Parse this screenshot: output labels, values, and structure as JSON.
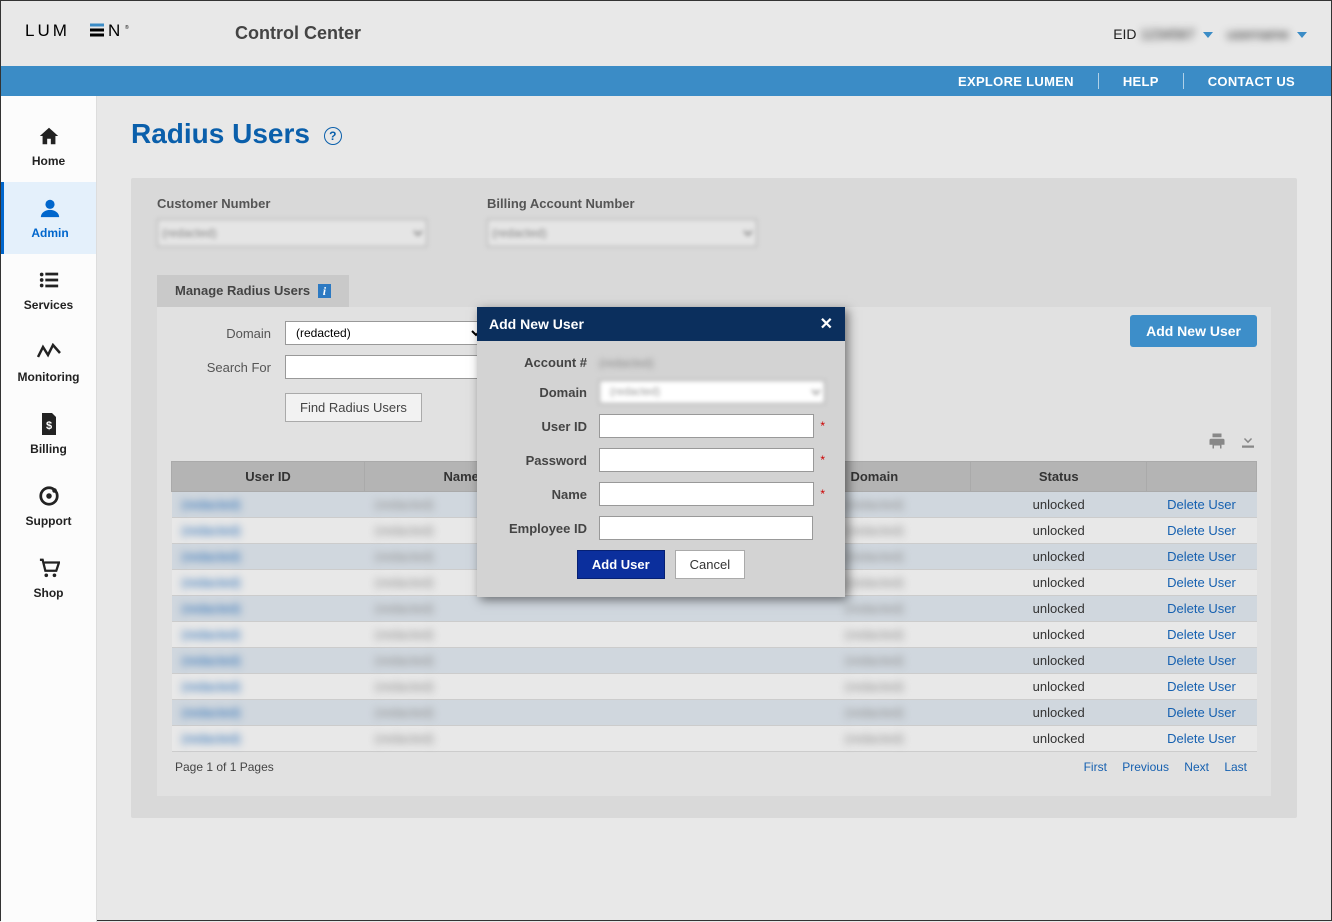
{
  "header": {
    "product_title": "Control Center",
    "eid_label": "EID",
    "eid_value": "1234567",
    "user_name": "username"
  },
  "topnav": {
    "explore": "EXPLORE LUMEN",
    "help": "HELP",
    "contact": "CONTACT US"
  },
  "sidebar": {
    "items": [
      {
        "key": "home",
        "label": "Home"
      },
      {
        "key": "admin",
        "label": "Admin"
      },
      {
        "key": "services",
        "label": "Services"
      },
      {
        "key": "monitoring",
        "label": "Monitoring"
      },
      {
        "key": "billing",
        "label": "Billing"
      },
      {
        "key": "support",
        "label": "Support"
      },
      {
        "key": "shop",
        "label": "Shop"
      }
    ]
  },
  "page": {
    "title": "Radius Users",
    "customer_number_label": "Customer Number",
    "billing_account_label": "Billing Account Number",
    "customer_number_value": "(redacted)",
    "billing_account_value": "(redacted)"
  },
  "manage": {
    "tab_label": "Manage Radius Users",
    "domain_label": "Domain",
    "domain_value": "(redacted)",
    "search_label": "Search For",
    "find_button": "Find Radius Users",
    "add_button": "Add New User",
    "columns": [
      "User ID",
      "Name",
      "",
      "Domain",
      "Status",
      ""
    ]
  },
  "table_rows": [
    {
      "user_id": "(redacted)",
      "name": "(redacted)",
      "col3": "",
      "domain": "(redacted)",
      "status": "unlocked",
      "action": "Delete User"
    },
    {
      "user_id": "(redacted)",
      "name": "(redacted)",
      "col3": "",
      "domain": "(redacted)",
      "status": "unlocked",
      "action": "Delete User"
    },
    {
      "user_id": "(redacted)",
      "name": "(redacted)",
      "col3": "",
      "domain": "(redacted)",
      "status": "unlocked",
      "action": "Delete User"
    },
    {
      "user_id": "(redacted)",
      "name": "(redacted)",
      "col3": "",
      "domain": "(redacted)",
      "status": "unlocked",
      "action": "Delete User"
    },
    {
      "user_id": "(redacted)",
      "name": "(redacted)",
      "col3": "",
      "domain": "(redacted)",
      "status": "unlocked",
      "action": "Delete User"
    },
    {
      "user_id": "(redacted)",
      "name": "(redacted)",
      "col3": "",
      "domain": "(redacted)",
      "status": "unlocked",
      "action": "Delete User"
    },
    {
      "user_id": "(redacted)",
      "name": "(redacted)",
      "col3": "",
      "domain": "(redacted)",
      "status": "unlocked",
      "action": "Delete User"
    },
    {
      "user_id": "(redacted)",
      "name": "(redacted)",
      "col3": "",
      "domain": "(redacted)",
      "status": "unlocked",
      "action": "Delete User"
    },
    {
      "user_id": "(redacted)",
      "name": "(redacted)",
      "col3": "",
      "domain": "(redacted)",
      "status": "unlocked",
      "action": "Delete User"
    },
    {
      "user_id": "(redacted)",
      "name": "(redacted)",
      "col3": "",
      "domain": "(redacted)",
      "status": "unlocked",
      "action": "Delete User"
    }
  ],
  "pager": {
    "status": "Page 1 of 1 Pages",
    "first": "First",
    "prev": "Previous",
    "next": "Next",
    "last": "Last"
  },
  "modal": {
    "title": "Add New User",
    "account_label": "Account #",
    "account_value": "(redacted)",
    "domain_label": "Domain",
    "domain_value": "(redacted)",
    "userid_label": "User ID",
    "password_label": "Password",
    "name_label": "Name",
    "empid_label": "Employee ID",
    "add_btn": "Add User",
    "cancel_btn": "Cancel"
  }
}
